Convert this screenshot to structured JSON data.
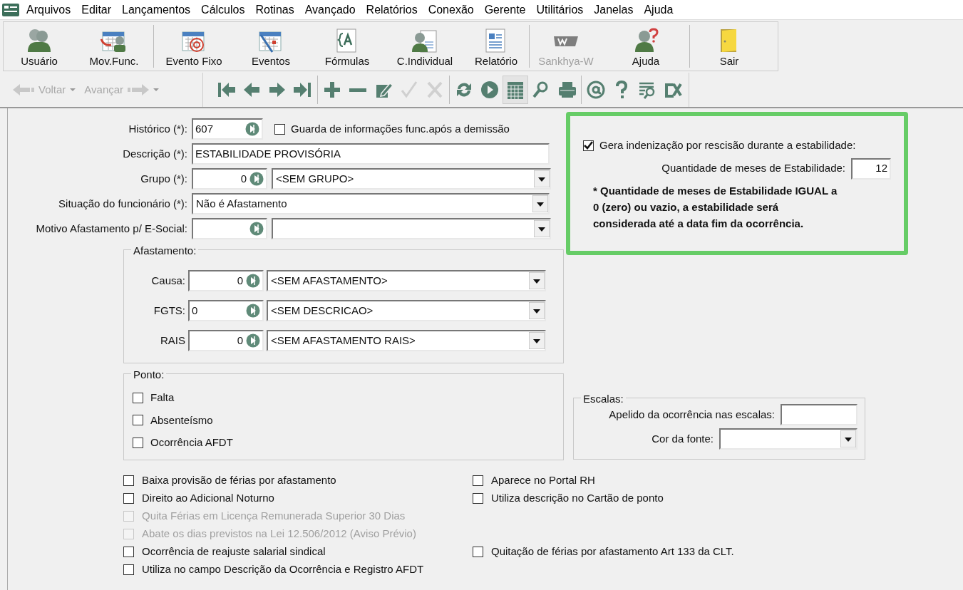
{
  "menu": [
    "Arquivos",
    "Editar",
    "Lançamentos",
    "Cálculos",
    "Rotinas",
    "Avançado",
    "Relatórios",
    "Conexão",
    "Gerente",
    "Utilitários",
    "Janelas",
    "Ajuda"
  ],
  "toolbar": [
    {
      "label": "Usuário",
      "disabled": false
    },
    {
      "label": "Mov.Func.",
      "disabled": false
    },
    {
      "label": "Evento Fixo",
      "disabled": false
    },
    {
      "label": "Eventos",
      "disabled": false
    },
    {
      "label": "Fórmulas",
      "disabled": false
    },
    {
      "label": "C.Individual",
      "disabled": false
    },
    {
      "label": "Relatório",
      "disabled": false
    },
    {
      "label": "Sankhya-W",
      "disabled": true
    },
    {
      "label": "Ajuda",
      "disabled": false
    },
    {
      "label": "Sair",
      "disabled": false
    }
  ],
  "history_nav": [
    {
      "label": "Voltar",
      "disabled": true
    },
    {
      "label": "Avançar",
      "disabled": true
    }
  ],
  "nav_icons": [
    {
      "disabled": false,
      "selected": false
    },
    {
      "disabled": false,
      "selected": false
    },
    {
      "disabled": false,
      "selected": false
    },
    {
      "disabled": false,
      "selected": false
    },
    {
      "disabled": false,
      "selected": false
    },
    {
      "disabled": false,
      "selected": false
    },
    {
      "disabled": false,
      "selected": false
    },
    {
      "disabled": true,
      "selected": false
    },
    {
      "disabled": true,
      "selected": false
    },
    {
      "disabled": false,
      "selected": false
    },
    {
      "disabled": false,
      "selected": false
    },
    {
      "disabled": false,
      "selected": true
    },
    {
      "disabled": false,
      "selected": false
    },
    {
      "disabled": false,
      "selected": false
    },
    {
      "disabled": false,
      "selected": false
    },
    {
      "disabled": false,
      "selected": false
    },
    {
      "disabled": false,
      "selected": false
    },
    {
      "disabled": false,
      "selected": false
    }
  ],
  "fields": [
    {
      "kind": "code_check",
      "label": "Histórico (*):",
      "code": "607",
      "check_label": "Guarda de informações func.após a demissão",
      "checked": false
    },
    {
      "kind": "text",
      "label": "Descrição (*):",
      "value": "ESTABILIDADE PROVISÓRIA"
    },
    {
      "kind": "code_select",
      "label": "Grupo (*):",
      "code": "0",
      "value": "<SEM GRUPO>"
    },
    {
      "kind": "select",
      "label": "Situação do funcionário (*):",
      "value": "Não é Afastamento"
    },
    {
      "kind": "code_select",
      "label": "Motivo Afastamento p/ E-Social:"
    }
  ],
  "afastamento": {
    "title": "Afastamento:",
    "rows": [
      {
        "label": "Causa:",
        "code": "0",
        "value": "<SEM AFASTAMENTO>"
      },
      {
        "label": "FGTS:",
        "code": "0",
        "value": "<SEM DESCRICAO>"
      },
      {
        "label": "RAIS",
        "code": "0",
        "value": "<SEM AFASTAMENTO RAIS>"
      }
    ]
  },
  "estabilidade": {
    "check_label": "Gera indenização por rescisão durante a estabilidade:",
    "checked": true,
    "months_label": "Quantidade de meses de Estabilidade:",
    "months": "12",
    "note": "* Quantidade de meses de Estabilidade IGUAL a 0 (zero) ou vazio, a estabilidade será considerada até a data fim da ocorrência."
  },
  "ponto": {
    "title": "Ponto:",
    "items": [
      {
        "label": "Falta",
        "checked": false
      },
      {
        "label": "Absenteísmo",
        "checked": false
      },
      {
        "label": "Ocorrência AFDT",
        "checked": false
      }
    ]
  },
  "escalas": {
    "title": "Escalas:",
    "nickname_label": "Apelido da ocorrência nas escalas:",
    "font_color_label": "Cor da fonte:"
  },
  "options": [
    {
      "left": {
        "label": "Baixa provisão de férias por afastamento",
        "checked": false,
        "disabled": false
      },
      "right": {
        "label": "Aparece no Portal RH",
        "checked": false,
        "disabled": false
      }
    },
    {
      "left": {
        "label": "Direito ao Adicional Noturno",
        "checked": false,
        "disabled": false
      },
      "right": {
        "label": "Utiliza descrição no Cartão de ponto",
        "checked": false,
        "disabled": false
      }
    },
    {
      "left": {
        "label": "Quita Férias em Licença Remunerada Superior 30 Dias",
        "checked": false,
        "disabled": true
      }
    },
    {
      "left": {
        "label": "Abate os dias previstos na Lei 12.506/2012 (Aviso Prévio)",
        "checked": false,
        "disabled": true
      }
    },
    {
      "left": {
        "label": "Ocorrência de reajuste salarial sindical",
        "checked": false,
        "disabled": false
      },
      "right": {
        "label": "Quitação de férias por afastamento Art 133 da CLT.",
        "checked": false,
        "disabled": false
      }
    },
    {
      "left": {
        "label": "Utiliza no campo Descrição da Ocorrência e Registro AFDT",
        "checked": false,
        "disabled": false
      }
    }
  ]
}
